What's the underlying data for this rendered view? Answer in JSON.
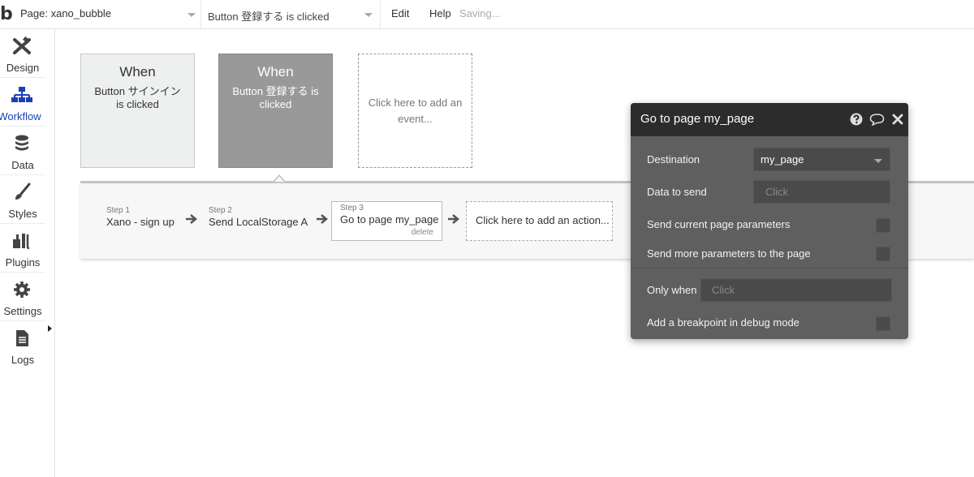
{
  "topbar": {
    "logo": "b",
    "page_select": "Page: xano_bubble",
    "event_select": "Button 登録する is clicked",
    "menu_edit": "Edit",
    "menu_help": "Help",
    "status": "Saving..."
  },
  "sidebar": {
    "items": [
      {
        "label": "Design",
        "icon": "design-icon"
      },
      {
        "label": "Workflow",
        "icon": "workflow-icon",
        "active": true
      },
      {
        "label": "Data",
        "icon": "database-icon"
      },
      {
        "label": "Styles",
        "icon": "brush-icon"
      },
      {
        "label": "Plugins",
        "icon": "plugins-icon"
      },
      {
        "label": "Settings",
        "icon": "gear-icon"
      },
      {
        "label": "Logs",
        "icon": "document-icon"
      }
    ]
  },
  "events": [
    {
      "when": "When",
      "desc": "Button サインイン is clicked"
    },
    {
      "when": "When",
      "desc": "Button 登録する is clicked"
    },
    {
      "desc": "Click here to add an event..."
    }
  ],
  "actions": {
    "steps": [
      {
        "num": "Step 1",
        "name": "Xano - sign up"
      },
      {
        "num": "Step 2",
        "name": "Send LocalStorage A"
      },
      {
        "num": "Step 3",
        "name": "Go to page my_page",
        "delete": "delete"
      }
    ],
    "add_action": "Click here to add an action..."
  },
  "panel": {
    "title": "Go to page my_page",
    "destination_label": "Destination",
    "destination_value": "my_page",
    "data_to_send_label": "Data to send",
    "data_to_send_placeholder": "Click",
    "send_current_label": "Send current page parameters",
    "send_more_label": "Send more parameters to the page",
    "only_when_label": "Only when",
    "only_when_placeholder": "Click",
    "breakpoint_label": "Add a breakpoint in debug mode"
  },
  "colors": {
    "accent": "#1a3fb8",
    "panel_bg": "#5f5f5f",
    "panel_header": "#2c2c2c",
    "selected_event": "#999999"
  }
}
